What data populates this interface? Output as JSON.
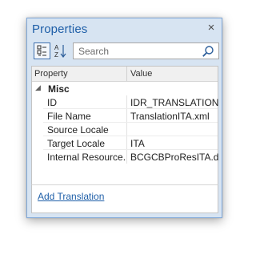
{
  "panel": {
    "title": "Properties"
  },
  "toolbar": {
    "search_placeholder": "Search"
  },
  "grid": {
    "columns": [
      "Property",
      "Value"
    ],
    "category": "Misc",
    "rows": [
      {
        "name": "ID",
        "value": "IDR_TRANSLATION..."
      },
      {
        "name": "File Name",
        "value": "TranslationITA.xml"
      },
      {
        "name": "Source Locale",
        "value": ""
      },
      {
        "name": "Target Locale",
        "value": "ITA"
      },
      {
        "name": "Internal Resource...",
        "value": "BCGCBProResITA.dll"
      }
    ]
  },
  "footer": {
    "link": "Add Translation"
  },
  "icons": {
    "close": "close-icon",
    "categorized": "categorized-icon",
    "alphabetical": "sort-az-icon",
    "search": "search-icon",
    "collapse": "collapse-triangle-icon"
  },
  "colors": {
    "title": "#1f5fa8",
    "link": "#1f5fa8",
    "border": "#7fa7d8",
    "background": "#d7e4f2"
  }
}
